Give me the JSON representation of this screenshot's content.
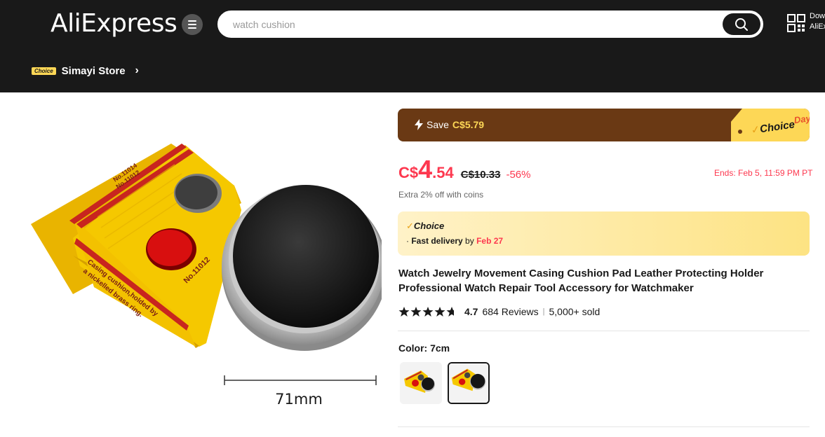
{
  "header": {
    "logo": "AliExpress",
    "search": {
      "placeholder": "watch cushion"
    },
    "download_line1": "Dow",
    "download_line2": "AliEx"
  },
  "store": {
    "badge": "Choice",
    "name": "Simayi Store"
  },
  "product_image": {
    "box_label_1": "No.11014",
    "box_label_2": "No.11012",
    "box_text_1": "Casing cushion,holded by",
    "box_text_2": "a nickelled brass ring.",
    "box_label_3": "No.11012",
    "dimension": "71mm"
  },
  "promo": {
    "save_label": "Save",
    "save_amount": "C$5.79",
    "choice_day_choice": "Choice",
    "choice_day_day": "Day"
  },
  "price": {
    "currency": "C$",
    "integer": "4",
    "decimal": ".54",
    "original": "C$10.33",
    "discount": "-56%",
    "ends": "Ends: Feb 5, 11:59 PM PT",
    "coins": "Extra 2% off with coins"
  },
  "choice_box": {
    "title": "Choice",
    "delivery_prefix": "· ",
    "delivery_label": "Fast delivery",
    "delivery_by": " by ",
    "delivery_date": "Feb 27"
  },
  "product": {
    "title": "Watch Jewelry Movement Casing Cushion Pad Leather Protecting Holder Professional Watch Repair Tool Accessory for Watchmaker",
    "rating": "4.7",
    "rating_value": 4.7,
    "reviews": "684 Reviews",
    "separator": "|",
    "sold": "5,000+ sold"
  },
  "variants": {
    "label": "Color: 7cm",
    "options": [
      "Yellow",
      "Black"
    ],
    "selected_index": 1
  },
  "colors": {
    "header_bg": "#191919",
    "price_red": "#fd384f",
    "banner_brown": "#6a3914",
    "choice_yellow": "#fdd756"
  }
}
